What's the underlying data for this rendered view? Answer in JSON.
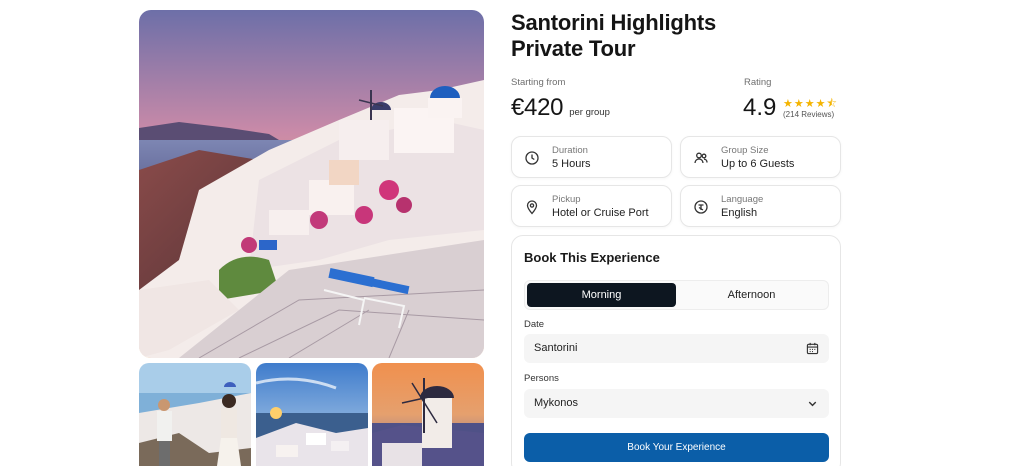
{
  "tour": {
    "title": "Santorini Highlights Private Tour"
  },
  "price": {
    "label": "Starting from",
    "amount": "€420",
    "unit": "per group"
  },
  "rating": {
    "label": "Rating",
    "value": "4.9",
    "stars": 4.5,
    "reviews": "(214 Reviews)"
  },
  "info_cards": [
    {
      "label": "Duration",
      "value": "5 Hours",
      "icon": "clock-icon"
    },
    {
      "label": "Group Size",
      "value": "Up to 6 Guests",
      "icon": "users-icon"
    },
    {
      "label": "Pickup",
      "value": "Hotel or Cruise Port",
      "icon": "map-pin-icon"
    },
    {
      "label": "Language",
      "value": "English",
      "icon": "language-icon"
    }
  ],
  "booking": {
    "title": "Book This Experience",
    "tabs": [
      {
        "label": "Morning",
        "active": true
      },
      {
        "label": "Afternoon",
        "active": false
      }
    ],
    "date_label": "Date",
    "date_value": "Santorini",
    "persons_label": "Persons",
    "persons_value": "Mykonos",
    "button_label": "Book Your Experience"
  },
  "gallery": {
    "main": "santorini-village-sunset-photo",
    "thumbnails": [
      "couple-santorini-photo",
      "santorini-sunset-sea-photo",
      "windmill-sunset-photo"
    ]
  },
  "colors": {
    "primary_button": "#0b5ea8",
    "active_tab": "#0d1620",
    "star": "#f4b400"
  }
}
